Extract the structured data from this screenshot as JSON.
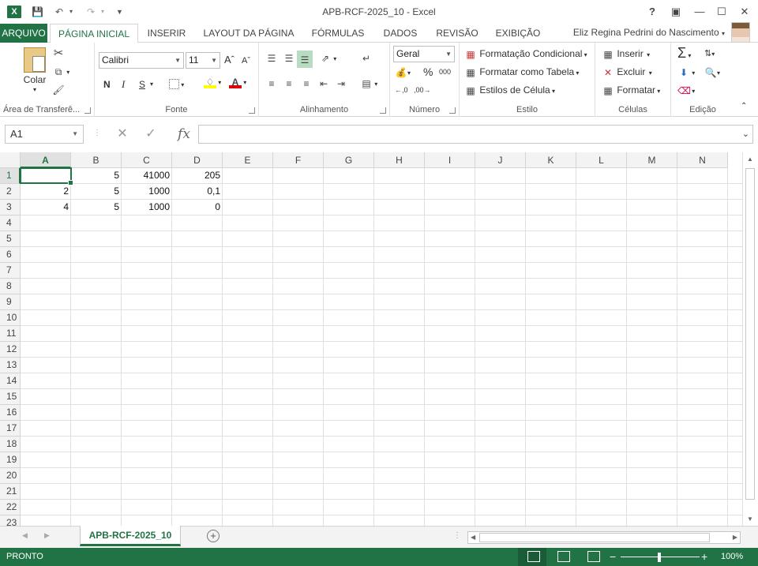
{
  "window": {
    "title": "APB-RCF-2025_10 - Excel",
    "app_logo": "X",
    "accent": "#217346"
  },
  "tabs": [
    {
      "label": "ARQUIVO"
    },
    {
      "label": "PÁGINA INICIAL"
    },
    {
      "label": "INSERIR"
    },
    {
      "label": "LAYOUT DA PÁGINA"
    },
    {
      "label": "FÓRMULAS"
    },
    {
      "label": "DADOS"
    },
    {
      "label": "REVISÃO"
    },
    {
      "label": "EXIBIÇÃO"
    }
  ],
  "user": {
    "name": "Eliz Regina Pedrini do Nascimento"
  },
  "ribbon": {
    "clipboard": {
      "paste": "Colar",
      "label": "Área de Transferê..."
    },
    "font": {
      "name": "Calibri",
      "size": "11",
      "bold": "N",
      "italic": "I",
      "underline": "S",
      "label": "Fonte"
    },
    "alignment": {
      "label": "Alinhamento"
    },
    "number": {
      "format": "Geral",
      "label": "Número",
      "percent": "%",
      "thousands": "000"
    },
    "styles": {
      "conditional": "Formatação Condicional",
      "as_table": "Formatar como Tabela",
      "cell_styles": "Estilos de Célula",
      "label": "Estilo"
    },
    "cells": {
      "insert": "Inserir",
      "delete": "Excluir",
      "format": "Formatar",
      "label": "Células"
    },
    "editing": {
      "label": "Edição"
    }
  },
  "formula_bar": {
    "name_box": "A1",
    "fx": "fx",
    "value": ""
  },
  "grid": {
    "columns": [
      "A",
      "B",
      "C",
      "D",
      "E",
      "F",
      "G",
      "H",
      "I",
      "J",
      "K",
      "L",
      "M",
      "N"
    ],
    "rows": [
      "1",
      "2",
      "3",
      "4",
      "5",
      "6",
      "7",
      "8",
      "9",
      "10",
      "11",
      "12",
      "13",
      "14",
      "15",
      "16",
      "17",
      "18",
      "19",
      "20",
      "21",
      "22",
      "23"
    ],
    "cells": [
      [
        "",
        "5",
        "41000",
        "205"
      ],
      [
        "2",
        "5",
        "1000",
        "0,1"
      ],
      [
        "4",
        "5",
        "1000",
        "0"
      ]
    ]
  },
  "sheet_tabs": {
    "active": "APB-RCF-2025_10"
  },
  "status": {
    "mode": "PRONTO",
    "zoom": "100%"
  }
}
